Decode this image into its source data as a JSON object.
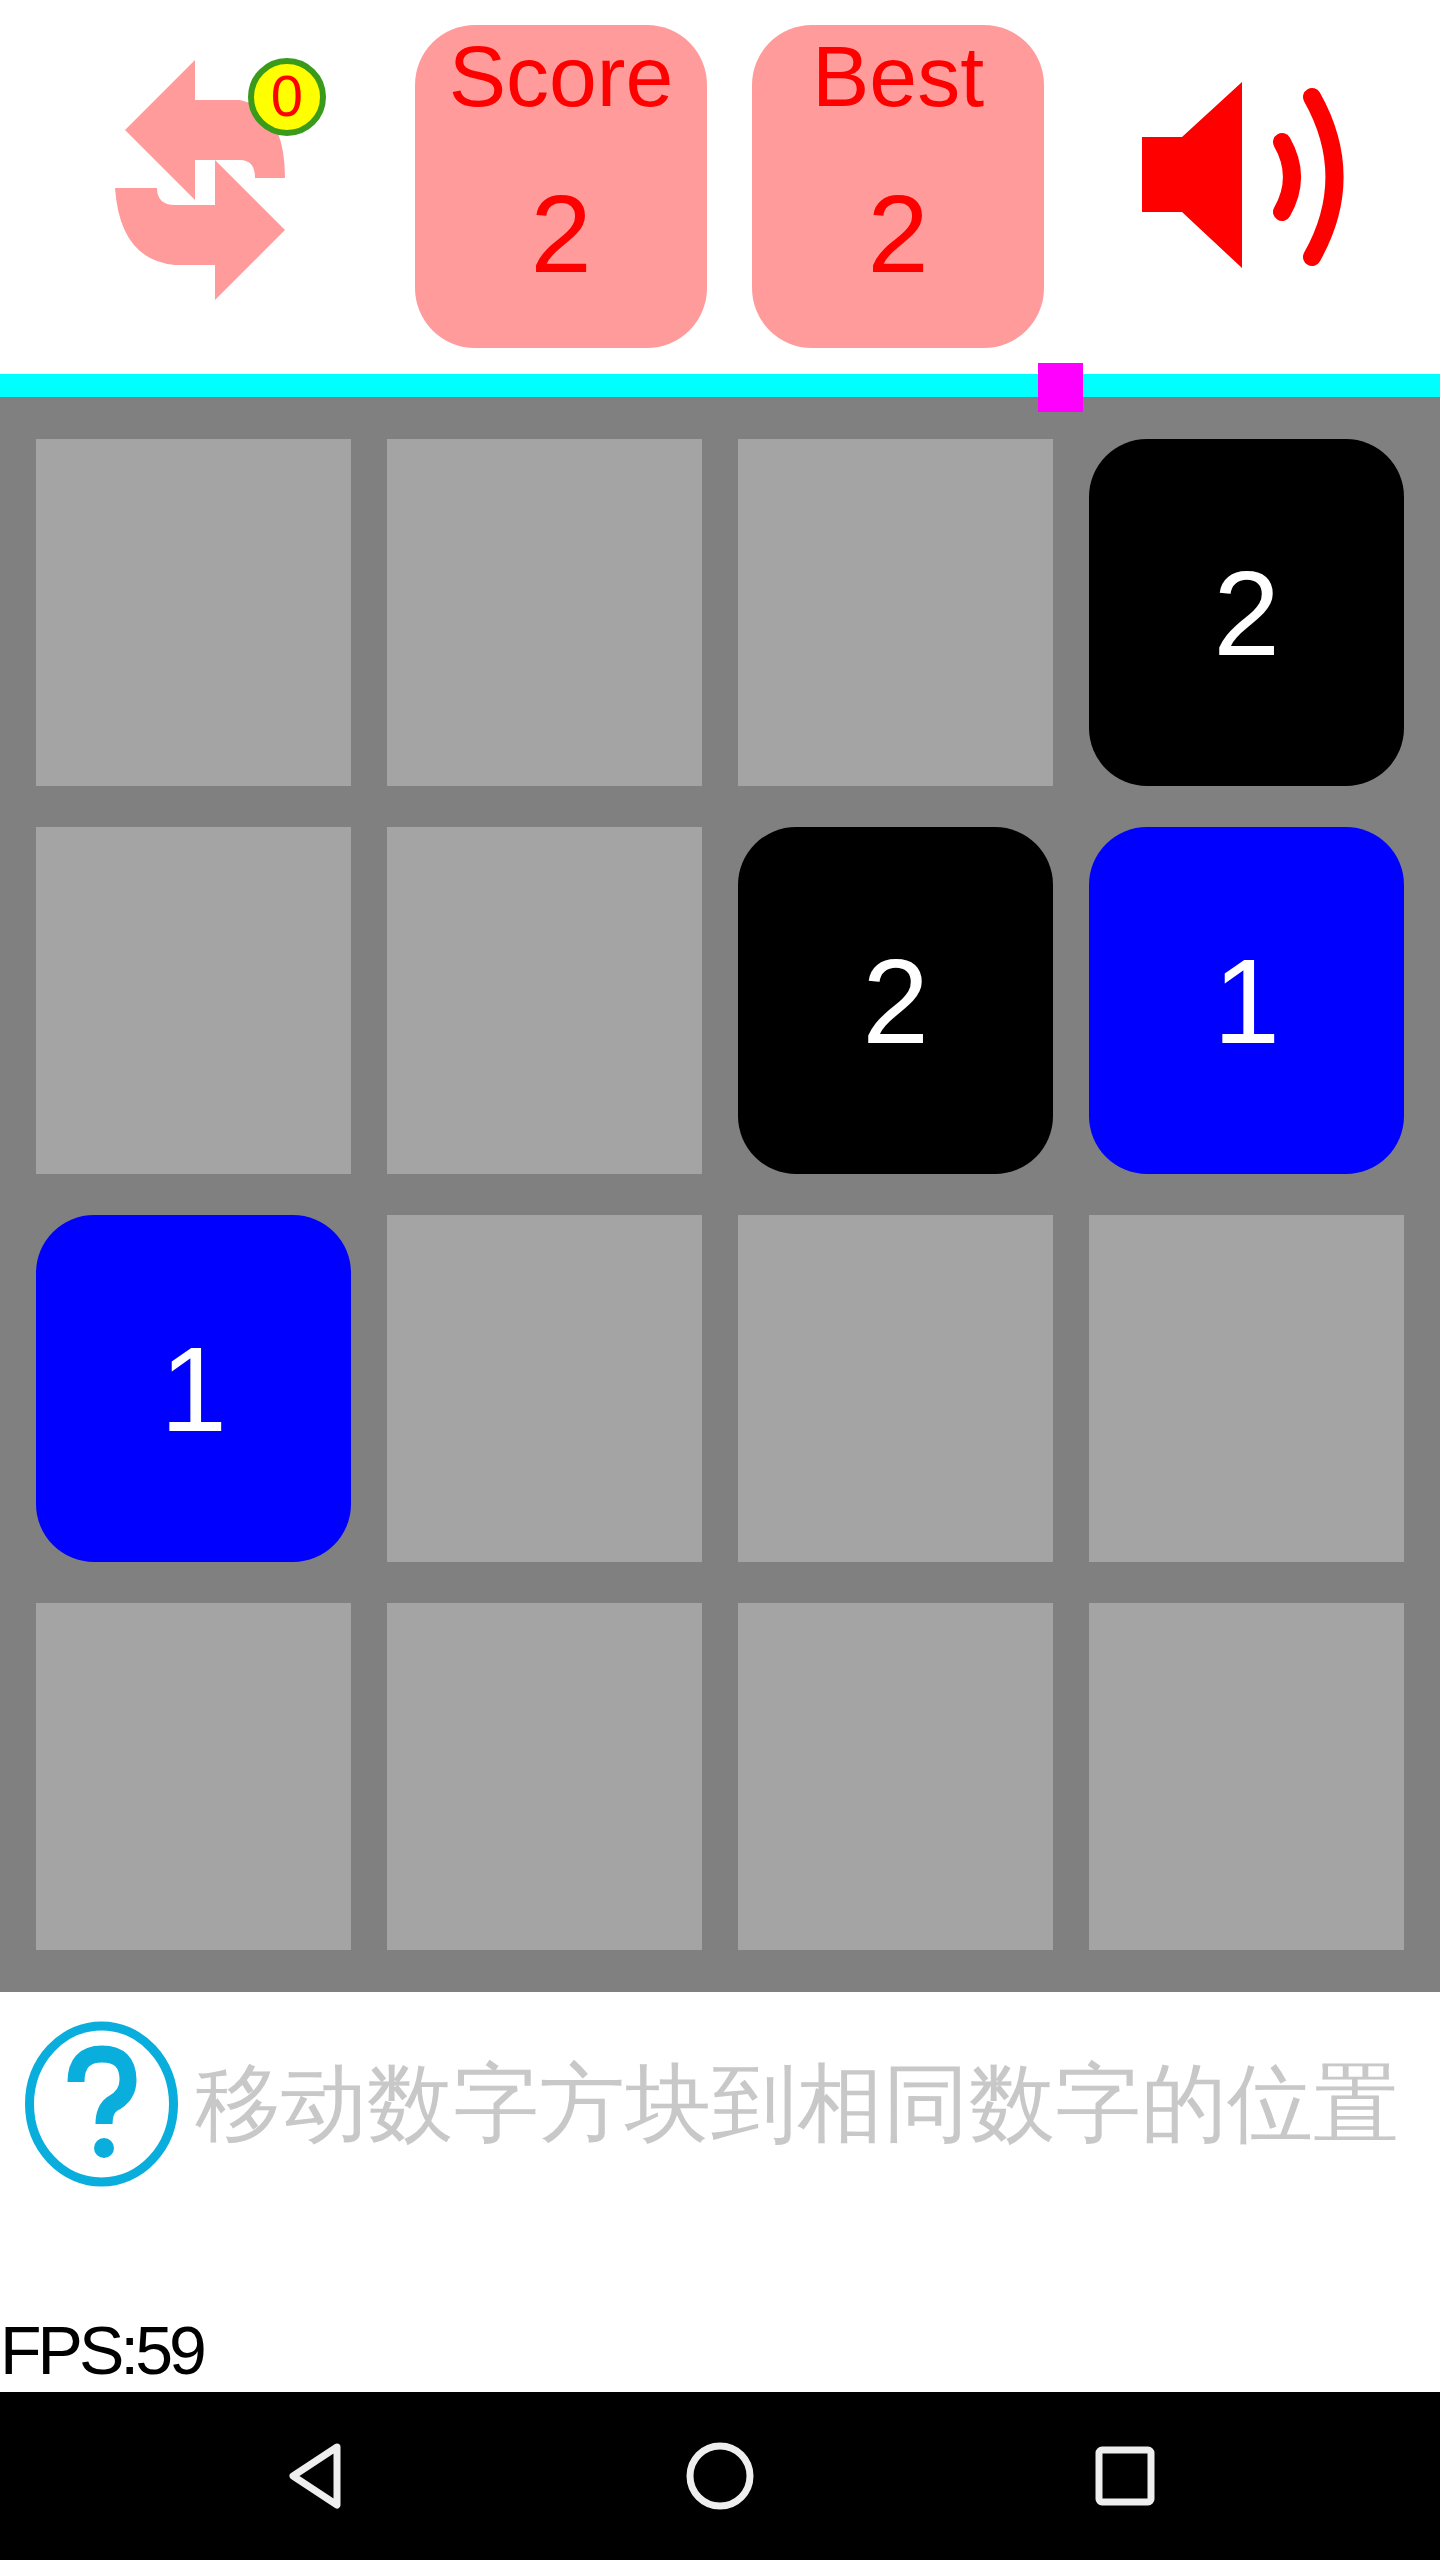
{
  "toolbar": {
    "restart": {
      "badge": "0"
    },
    "score": {
      "label": "Score",
      "value": "2"
    },
    "best": {
      "label": "Best",
      "value": "2"
    },
    "sound": {
      "on": true
    }
  },
  "progress": {
    "level": 0.736
  },
  "board": {
    "rows": [
      [
        {
          "kind": "empty"
        },
        {
          "kind": "empty"
        },
        {
          "kind": "empty"
        },
        {
          "kind": "tile",
          "value": "2",
          "color": "#000000"
        }
      ],
      [
        {
          "kind": "empty"
        },
        {
          "kind": "empty"
        },
        {
          "kind": "tile",
          "value": "2",
          "color": "#000000"
        },
        {
          "kind": "tile",
          "value": "1",
          "color": "#0000ff"
        }
      ],
      [
        {
          "kind": "tile",
          "value": "1",
          "color": "#0000ff"
        },
        {
          "kind": "empty"
        },
        {
          "kind": "empty"
        },
        {
          "kind": "empty"
        }
      ],
      [
        {
          "kind": "empty"
        },
        {
          "kind": "empty"
        },
        {
          "kind": "empty"
        },
        {
          "kind": "empty"
        }
      ]
    ]
  },
  "hint": {
    "text": "移动数字方块到相同数字的位置"
  },
  "fps": "FPS:59"
}
